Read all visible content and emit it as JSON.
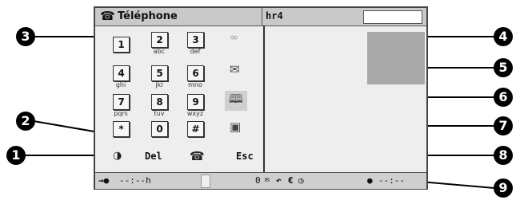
{
  "window": {
    "title": "Téléphone",
    "network": "hr4",
    "phone_icon": "☎"
  },
  "keypad": [
    {
      "key": "1",
      "sub": ""
    },
    {
      "key": "2",
      "sub": "abc"
    },
    {
      "key": "3",
      "sub": "def"
    },
    {
      "key": "4",
      "sub": "ghi"
    },
    {
      "key": "5",
      "sub": "jkl"
    },
    {
      "key": "6",
      "sub": "mno"
    },
    {
      "key": "7",
      "sub": "pqrs"
    },
    {
      "key": "8",
      "sub": "tuv"
    },
    {
      "key": "9",
      "sub": "wxyz"
    },
    {
      "key": "*",
      "sub": ""
    },
    {
      "key": "0",
      "sub": ""
    },
    {
      "key": "#",
      "sub": ""
    }
  ],
  "side_icons": [
    "voicemail-icon",
    "envelope-icon",
    "phonebook-icon",
    "contact-card-icon"
  ],
  "softkeys": {
    "left_icon": "speaker-icon",
    "del": "Del",
    "esc": "Esc",
    "hangup_icon": "hangup-icon"
  },
  "status": {
    "left_time": "--:--h",
    "right_time": "--:--",
    "mid": "0"
  },
  "callouts": {
    "c1": "1",
    "c2": "2",
    "c3": "3",
    "c4": "4",
    "c5": "5",
    "c6": "6",
    "c7": "7",
    "c8": "8",
    "c9": "9"
  }
}
